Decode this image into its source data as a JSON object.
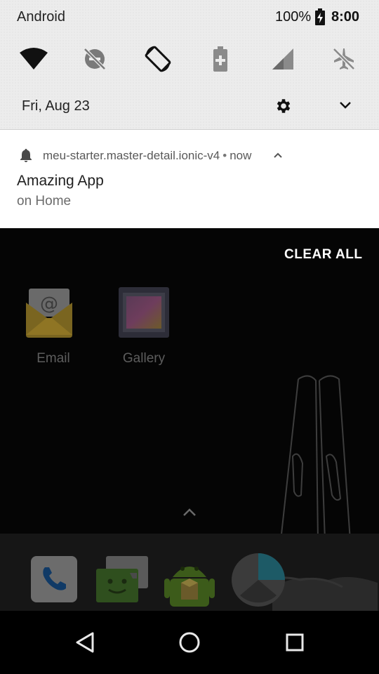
{
  "status_bar": {
    "carrier": "Android",
    "battery_percent": "100%",
    "time": "8:00"
  },
  "quick_settings": {
    "tiles": [
      {
        "icon": "wifi-icon"
      },
      {
        "icon": "do-not-disturb-off-icon"
      },
      {
        "icon": "auto-rotate-icon"
      },
      {
        "icon": "battery-saver-icon"
      },
      {
        "icon": "cellular-signal-icon"
      },
      {
        "icon": "airplane-mode-off-icon"
      }
    ],
    "date": "Fri, Aug 23"
  },
  "notification": {
    "app_name": "meu-starter.master-detail.ionic-v4",
    "separator": "•",
    "time": "now",
    "title": "Amazing App",
    "text": "on Home"
  },
  "clear_all_label": "CLEAR ALL",
  "home": {
    "apps": [
      {
        "label": "Email",
        "icon": "email-app-icon"
      },
      {
        "label": "Gallery",
        "icon": "gallery-app-icon"
      }
    ],
    "dock": [
      {
        "icon": "phone-app-icon"
      },
      {
        "icon": "messaging-app-icon"
      },
      {
        "icon": "android-app-icon"
      },
      {
        "icon": "browser-app-icon"
      }
    ]
  },
  "navigation": {
    "buttons": [
      {
        "icon": "back-icon"
      },
      {
        "icon": "home-icon"
      },
      {
        "icon": "recents-icon"
      }
    ]
  }
}
